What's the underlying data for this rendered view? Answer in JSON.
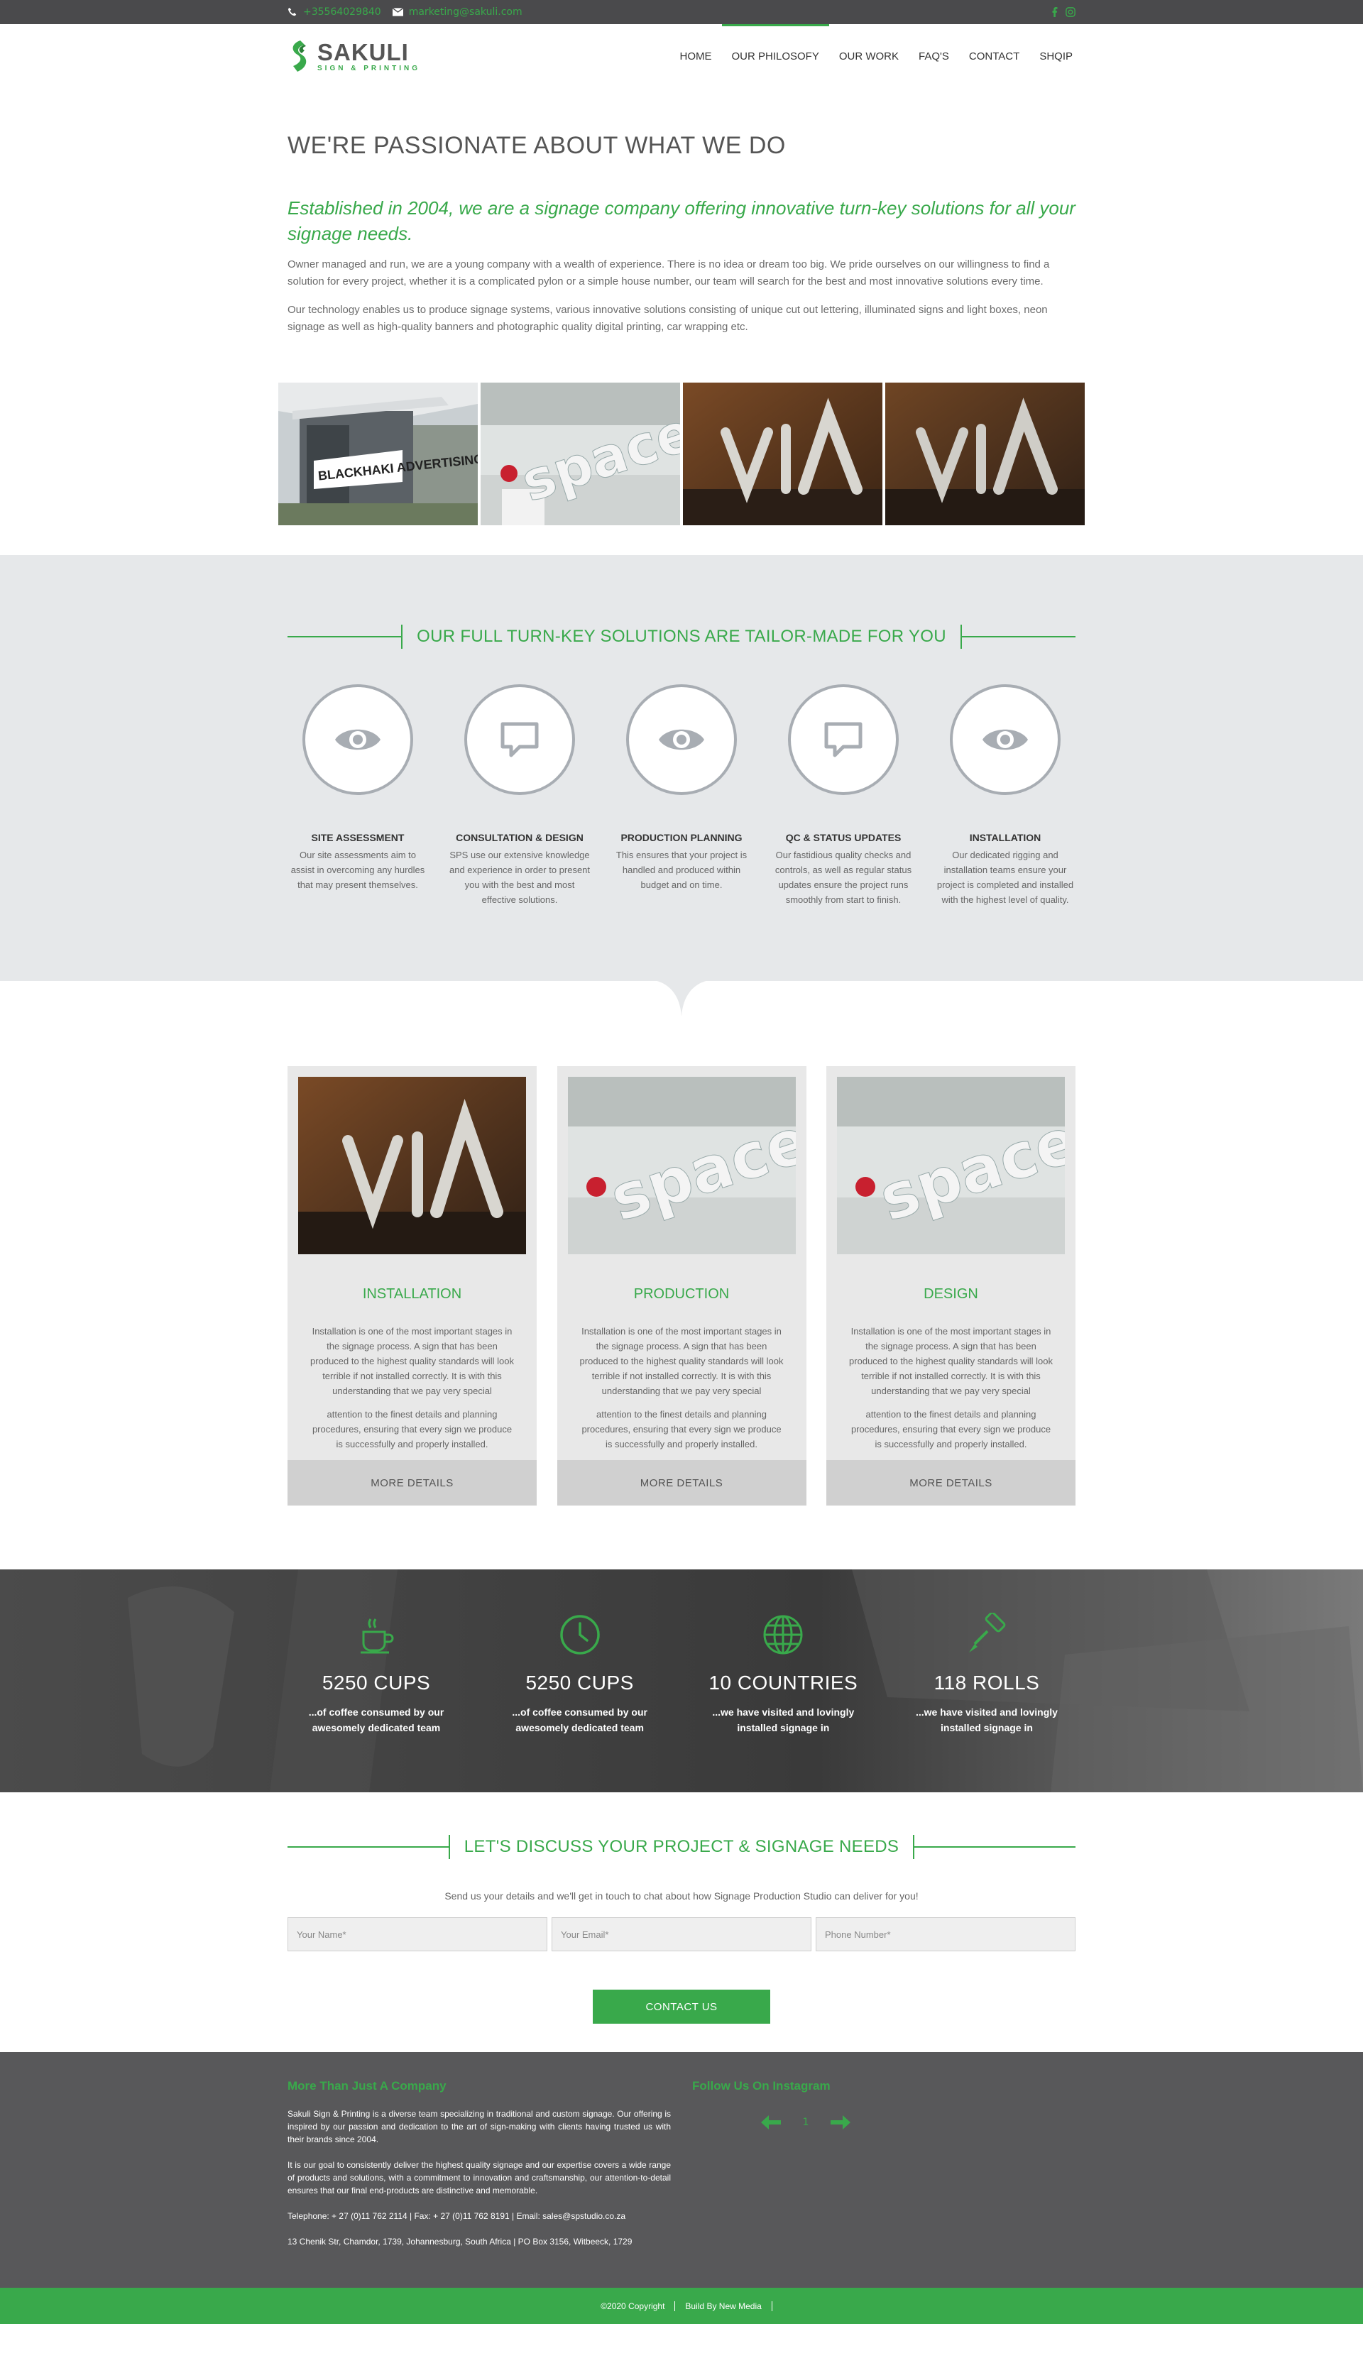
{
  "topbar": {
    "phone": "+35564029840",
    "email": "marketing@sakuli.com",
    "accent": "#39a94b"
  },
  "logo": {
    "name": "SAKULI",
    "tagline": "SIGN & PRINTING"
  },
  "nav": {
    "items": [
      {
        "label": "HOME"
      },
      {
        "label": "OUR PHILOSOFY",
        "active": true
      },
      {
        "label": "OUR WORK"
      },
      {
        "label": "FAQ'S"
      },
      {
        "label": "CONTACT"
      },
      {
        "label": "SHQIP"
      }
    ]
  },
  "intro": {
    "heading": "WE'RE PASSIONATE ABOUT WHAT WE DO",
    "lead": "Established in 2004, we are a signage company offering innovative turn-key solutions for all your signage needs.",
    "p1": "Owner managed and run, we are a young company with a wealth of experience. There is no idea or dream too big. We pride ourselves on our willingness to find a solution for every project, whether it is a complicated pylon or a simple house number, our team will search for the best and most innovative solutions every time.",
    "p2": "Our technology enables us to produce signage systems, various innovative solutions consisting of unique cut out lettering, illuminated signs and light boxes, neon signage as well as high-quality banners and photographic quality digital printing, car wrapping etc."
  },
  "gallery": [
    {
      "caption": "BLACKHAKI ADVERTISING",
      "kind": "building"
    },
    {
      "caption": "spaces",
      "kind": "spaces"
    },
    {
      "caption": "VIA",
      "kind": "via"
    },
    {
      "caption": "VIA",
      "kind": "via"
    }
  ],
  "solutions": {
    "title": "OUR FULL TURN-KEY SOLUTIONS ARE TAILOR-MADE FOR YOU",
    "items": [
      {
        "title": "SITE ASSESSMENT",
        "icon": "eye-icon",
        "text": "Our site assessments aim to assist in overcoming any hurdles that may present themselves."
      },
      {
        "title": "CONSULTATION & DESIGN",
        "icon": "speech-bubble-icon",
        "text": "SPS use our extensive knowledge and experience in order to present you with the best and most effective solutions."
      },
      {
        "title": "PRODUCTION PLANNING",
        "icon": "eye-icon",
        "text": "This ensures that your project is handled and produced within budget and on time."
      },
      {
        "title": "QC & STATUS UPDATES",
        "icon": "speech-bubble-icon",
        "text": "Our fastidious quality checks and controls, as well as regular status updates ensure the project runs smoothly from start to finish."
      },
      {
        "title": "INSTALLATION",
        "icon": "eye-icon",
        "text": "Our dedicated rigging and installation teams ensure your project is completed and installed with the highest level of quality."
      }
    ]
  },
  "cards": [
    {
      "title": "INSTALLATION",
      "image": "via",
      "p1": "Installation is one of the most important stages in the signage process. A sign that has been produced to the highest quality standards will look terrible if not installed correctly. It is with this understanding that we pay very special",
      "p2": "attention to the finest details and planning procedures, ensuring that every sign we produce is successfully and properly installed.",
      "button": "MORE DETAILS"
    },
    {
      "title": "PRODUCTION",
      "image": "spaces",
      "p1": "Installation is one of the most important stages in the signage process. A sign that has been produced to the highest quality standards will look terrible if not installed correctly. It is with this understanding that we pay very special",
      "p2": "attention to the finest details and planning procedures, ensuring that every sign we produce is successfully and properly installed.",
      "button": "MORE DETAILS"
    },
    {
      "title": "DESIGN",
      "image": "spaces",
      "p1": "Installation is one of the most important stages in the signage process. A sign that has been produced to the highest quality standards will look terrible if not installed correctly. It is with this understanding that we pay very special",
      "p2": "attention to the finest details and planning procedures, ensuring that every sign we produce is successfully and properly installed.",
      "button": "MORE DETAILS"
    }
  ],
  "stats": [
    {
      "icon": "coffee-cup-icon",
      "value": "5250 CUPS",
      "desc": "...of coffee consumed by our awesomely dedicated team"
    },
    {
      "icon": "clock-icon",
      "value": "5250 CUPS",
      "desc": "...of coffee consumed by our awesomely dedicated team"
    },
    {
      "icon": "globe-icon",
      "value": "10 COUNTRIES",
      "desc": "...we have visited and lovingly installed signage in"
    },
    {
      "icon": "paint-roller-icon",
      "value": "118 ROLLS",
      "desc": "...we have visited and lovingly installed signage in"
    }
  ],
  "contact": {
    "title": "LET'S DISCUSS YOUR PROJECT & SIGNAGE NEEDS",
    "sub": "Send us your details and we'll get in touch to chat about how Signage Production Studio can deliver for you!",
    "name_placeholder": "Your Name*",
    "email_placeholder": "Your Email*",
    "phone_placeholder": "Phone Number*",
    "button": "CONTACT US"
  },
  "footer": {
    "left_title": "More Than Just A Company",
    "p1": "Sakuli Sign & Printing is a diverse team specializing in traditional and custom signage. Our offering is inspired by our passion and dedication to the art of sign-making with clients having trusted us with their brands since 2004.",
    "p2": "It is our goal to consistently deliver the highest quality signage and our expertise covers a wide range of products and solutions, with a commitment to innovation and craftsmanship, our attention-to-detail ensures that our final end-products are distinctive and memorable.",
    "contact_line": "Telephone: + 27 (0)11 762 2114 | Fax: + 27 (0)11 762 8191 | Email: sales@spstudio.co.za",
    "address": "13 Chenik Str, Chamdor, 1739, Johannesburg, South Africa | PO Box 3156, Witbeeck, 1729",
    "right_title": "Follow Us On Instagram",
    "insta_page": "1"
  },
  "copyright": {
    "left": "©2020 Copyright",
    "right": "Build By New Media"
  }
}
